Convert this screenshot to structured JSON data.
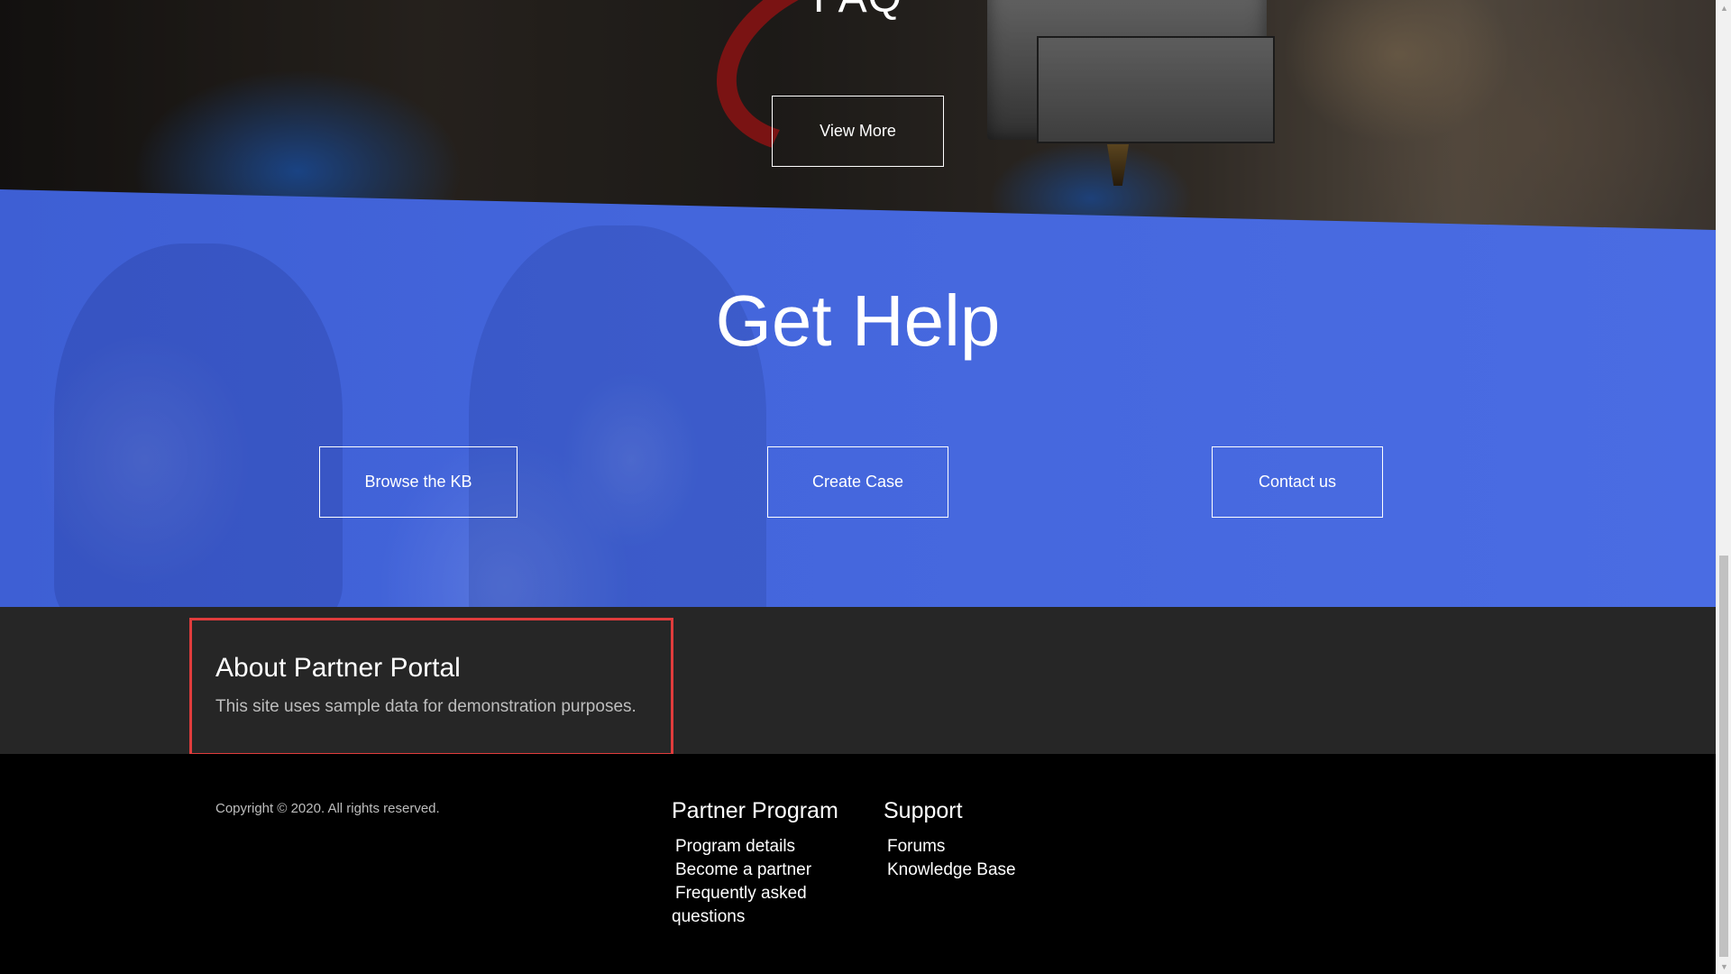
{
  "faq": {
    "title": "FAQ",
    "view_more_label": "View More"
  },
  "help": {
    "title": "Get Help",
    "buttons": [
      {
        "label": "Browse the KB"
      },
      {
        "label": "Create Case"
      },
      {
        "label": "Contact us"
      }
    ]
  },
  "about": {
    "title": "About Partner Portal",
    "text": "This site uses sample data for demonstration purposes."
  },
  "footer": {
    "copyright": "Copyright © 2020. All rights reserved.",
    "partner_program": {
      "title": "Partner Program",
      "links": [
        {
          "label": "Program details"
        },
        {
          "label": "Become a partner"
        },
        {
          "label": "Frequently asked questions"
        }
      ]
    },
    "support": {
      "title": "Support",
      "links": [
        {
          "label": "Forums"
        },
        {
          "label": "Knowledge Base"
        }
      ]
    }
  },
  "colors": {
    "help_blue": "#4466dc",
    "about_bg": "#262626",
    "footer_bg": "#000000",
    "highlight_border": "#e03c3c"
  },
  "scrollbar": {
    "up_icon": "arrow-up-icon",
    "down_icon": "arrow-down-icon"
  }
}
